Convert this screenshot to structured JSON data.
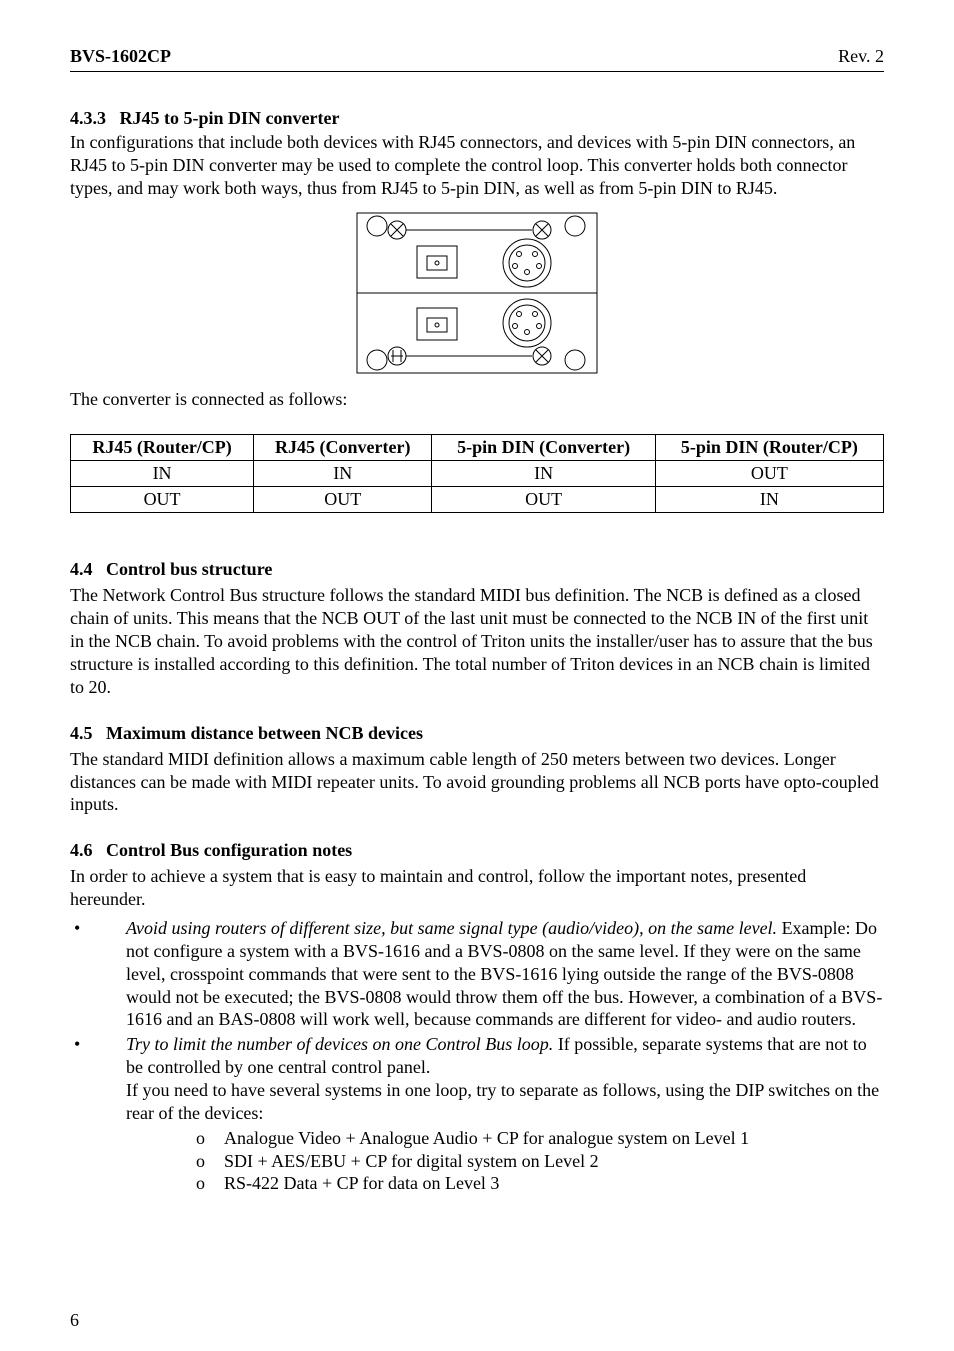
{
  "header": {
    "left": "BVS-1602CP",
    "right": "Rev. 2"
  },
  "s433": {
    "num": "4.3.3",
    "title": "RJ45 to 5-pin DIN converter",
    "para": "In configurations that include both devices with RJ45 connectors, and devices with 5-pin DIN connectors, an RJ45 to 5-pin DIN converter may be used to complete the control loop. This converter holds both connector types, and may work both ways, thus from RJ45 to 5-pin DIN, as well as from 5-pin DIN to RJ45."
  },
  "table_intro": "The converter is connected as follows:",
  "table": {
    "headers": [
      "RJ45 (Router/CP)",
      "RJ45 (Converter)",
      "5-pin DIN (Converter)",
      "5-pin DIN (Router/CP)"
    ],
    "rows": [
      [
        "IN",
        "IN",
        "IN",
        "OUT"
      ],
      [
        "OUT",
        "OUT",
        "OUT",
        "IN"
      ]
    ]
  },
  "s44": {
    "num": "4.4",
    "title": "Control bus structure",
    "para": "The Network Control Bus structure follows the standard MIDI bus definition. The NCB is defined as a closed chain of units. This means that the NCB OUT of the last unit must be connected to the NCB IN of the first unit in the NCB chain. To avoid problems with the control of Triton units the installer/user has to assure that the bus structure is installed according to this definition. The total number of Triton devices in an NCB chain is limited to 20."
  },
  "s45": {
    "num": "4.5",
    "title": "Maximum distance between NCB devices",
    "para": "The standard MIDI definition allows a maximum cable length of 250 meters between two devices. Longer distances can be made with MIDI repeater units. To avoid grounding problems all NCB ports have opto-coupled inputs."
  },
  "s46": {
    "num": "4.6",
    "title": "Control Bus configuration notes",
    "para": "In order to achieve a system that is easy to maintain and control, follow the important notes, presented hereunder."
  },
  "bullet1": {
    "lead": "Avoid using routers of different size, but same signal type (audio/video), on the same level.",
    "rest": " Example: Do not configure a system with a BVS-1616 and a BVS-0808 on the same level. If they were on the same level, crosspoint commands that were sent to the BVS-1616 lying outside the range of the BVS-0808 would not be executed; the BVS-0808 would throw them off the bus. However, a combination of a BVS-1616 and an BAS-0808 will work well, because commands are different for video- and audio routers."
  },
  "bullet2": {
    "lead": "Try to limit the number of devices on one Control Bus loop.",
    "rest1": " If possible, separate systems that are not to be controlled by one central control panel.",
    "rest2": "If you need to have several systems in one loop, try to separate as follows, using the DIP switches on the rear of the devices:",
    "subs": [
      "Analogue Video + Analogue Audio + CP for analogue system on Level 1",
      "SDI + AES/EBU + CP for digital system on Level 2",
      "RS-422 Data + CP for data on Level 3"
    ]
  },
  "pagenum": "6"
}
